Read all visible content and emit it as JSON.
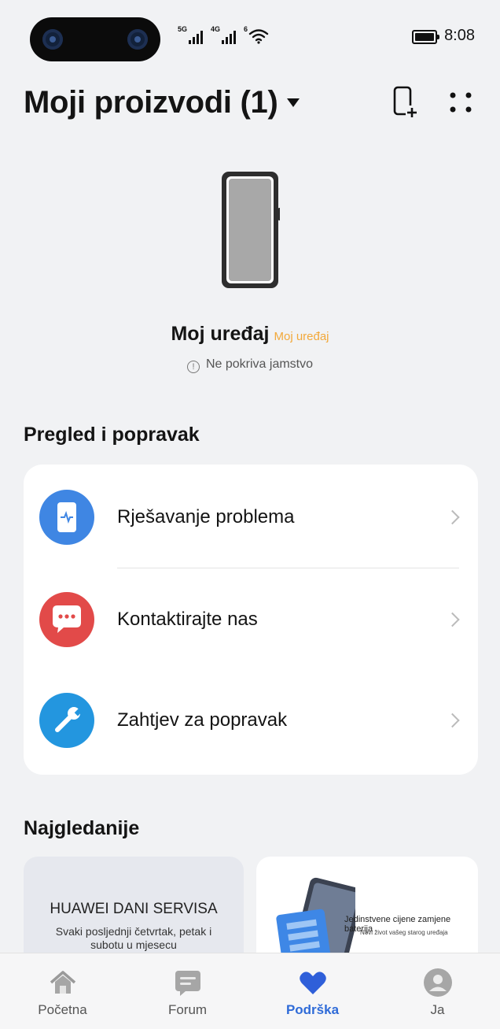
{
  "status_bar": {
    "network_1": "5G",
    "network_2": "4G",
    "wifi_tag": "6",
    "time": "8:08"
  },
  "header": {
    "title": "Moji proizvodi (1)"
  },
  "device": {
    "name": "Moj uređaj",
    "badge": "Moj uređaj",
    "warranty_status": "Ne pokriva jamstvo",
    "warranty_icon_glyph": "!"
  },
  "section_repair": {
    "title": "Pregled i popravak",
    "items": [
      {
        "label": "Rješavanje problema",
        "icon": "phone-diagnostics-icon",
        "color": "#3f86e3"
      },
      {
        "label": "Kontaktirajte nas",
        "icon": "chat-bubble-icon",
        "color": "#e24a49"
      },
      {
        "label": "Zahtjev za popravak",
        "icon": "wrench-icon",
        "color": "#2396df"
      }
    ]
  },
  "section_popular": {
    "title": "Najgledanije",
    "promos": [
      {
        "title": "HUAWEI DANI SERVISA",
        "subtitle": "Svaki posljednji četvrtak, petak i subotu u mjesecu"
      },
      {
        "title": "Jedinstvene cijene zamjene baterija",
        "subtitle": "Novi život vašeg starog uređaja"
      }
    ]
  },
  "bottom_nav": {
    "active_color": "#2f6bd8",
    "items": [
      {
        "label": "Početna",
        "icon": "home-icon"
      },
      {
        "label": "Forum",
        "icon": "forum-icon"
      },
      {
        "label": "Podrška",
        "icon": "heart-icon"
      },
      {
        "label": "Ja",
        "icon": "profile-icon"
      }
    ]
  }
}
